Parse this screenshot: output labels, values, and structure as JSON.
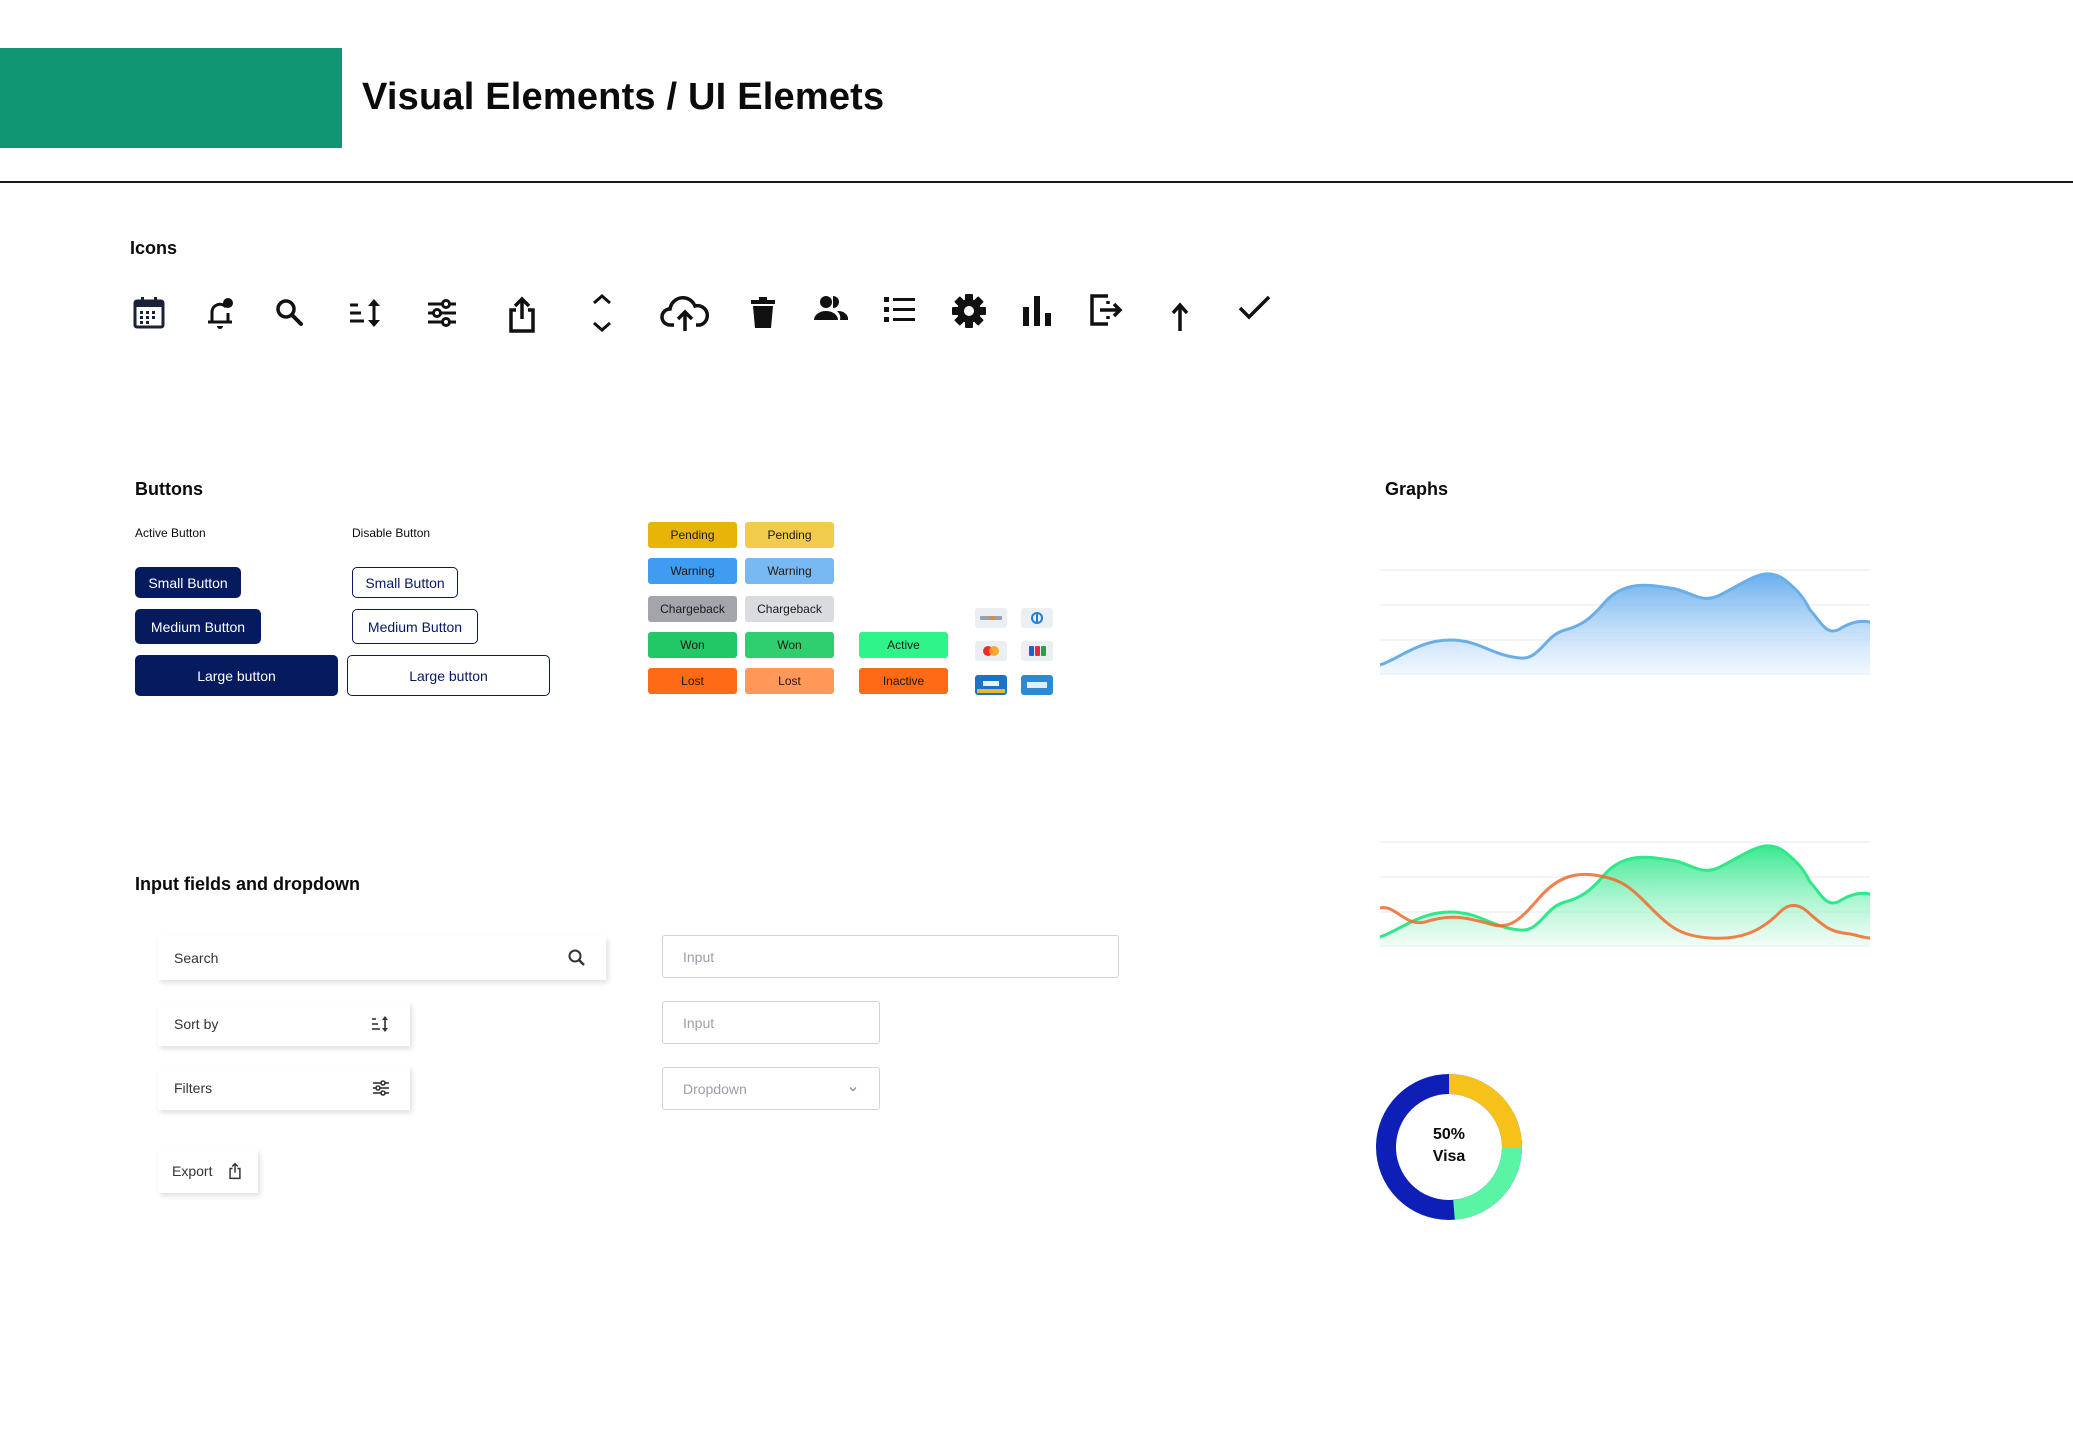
{
  "header": {
    "title": "Visual Elements / UI Elemets"
  },
  "colors": {
    "brand_green": "#109572",
    "navy": "#061a5e"
  },
  "icons_section": {
    "title": "Icons",
    "icons": [
      "calendar-icon",
      "bell-icon",
      "search-icon",
      "sort-icon",
      "filter-icon",
      "share-icon",
      "expand-icon",
      "cloud-upload-icon",
      "trash-icon",
      "users-icon",
      "list-icon",
      "gear-icon",
      "bar-chart-icon",
      "logout-icon",
      "arrow-up-icon",
      "check-icon"
    ]
  },
  "buttons_section": {
    "title": "Buttons",
    "active_label": "Active Button",
    "disabled_label": "Disable Button",
    "small": "Small Button",
    "medium": "Medium Button",
    "large": "Large button"
  },
  "badges": {
    "pending": "Pending",
    "warning": "Warning",
    "chargeback": "Chargeback",
    "won": "Won",
    "lost": "Lost",
    "active": "Active",
    "inactive": "Inactive"
  },
  "payment_cards": [
    "discover-card-icon",
    "diners-card-icon",
    "mastercard-icon",
    "jcb-card-icon",
    "visa-card-icon",
    "amex-card-icon"
  ],
  "inputs_section": {
    "title": "Input fields and dropdown",
    "search_label": "Search",
    "sort_label": "Sort by",
    "filters_label": "Filters",
    "export_label": "Export",
    "input_placeholder": "Input",
    "dropdown_placeholder": "Dropdown"
  },
  "graphs_section": {
    "title": "Graphs"
  },
  "donut": {
    "percent": "50%",
    "label": "Visa"
  },
  "chart_data": [
    {
      "type": "area",
      "series": [
        {
          "color": "#6aaee8"
        }
      ]
    },
    {
      "type": "area",
      "series": [
        {
          "color": "#2ee88a"
        },
        {
          "color": "#f06a2a"
        }
      ]
    },
    {
      "type": "pie",
      "values": [
        50,
        25,
        25
      ],
      "colors": [
        "#0e1fb8",
        "#f6c21a",
        "#5af5a4"
      ]
    }
  ]
}
